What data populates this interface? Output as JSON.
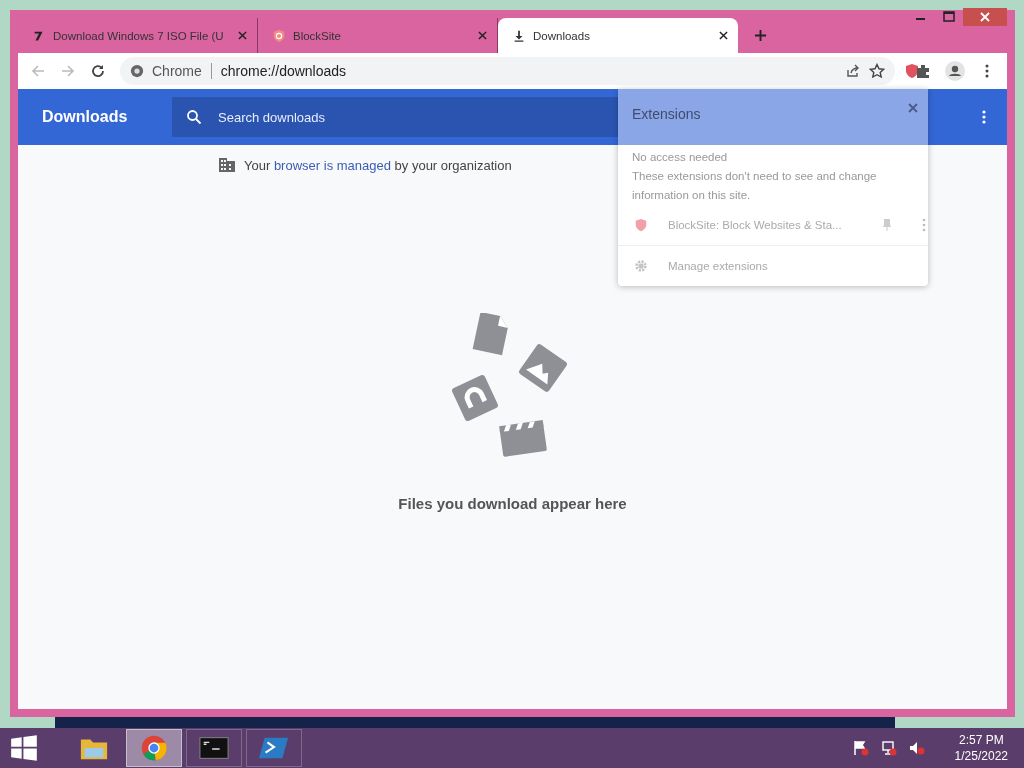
{
  "tabs": [
    {
      "kind": "site",
      "title": "Download Windows 7 ISO File (U",
      "selected": false
    },
    {
      "kind": "shield",
      "title": "BlockSite",
      "selected": false
    },
    {
      "kind": "download",
      "title": "Downloads",
      "selected": true
    }
  ],
  "address": {
    "scheme_label": "Chrome",
    "url": "chrome://downloads"
  },
  "page": {
    "title": "Downloads",
    "search_placeholder": "Search downloads",
    "notice_before": "Your ",
    "notice_link": "browser is managed",
    "notice_after": " by your organization",
    "empty_message": "Files you download appear here"
  },
  "extensions_popup": {
    "title": "Extensions",
    "section": "No access needed",
    "description": "These extensions don't need to see and change information on this site.",
    "items": [
      {
        "name": "BlockSite: Block Websites & Sta..."
      }
    ],
    "manage": "Manage extensions"
  },
  "taskbar": {
    "apps": [
      {
        "kind": "explorer",
        "selected": false
      },
      {
        "kind": "chrome",
        "selected": true
      },
      {
        "kind": "terminal",
        "selected": false
      },
      {
        "kind": "powershell",
        "selected": false
      }
    ],
    "time": "2:57 PM",
    "date": "1/25/2022"
  }
}
